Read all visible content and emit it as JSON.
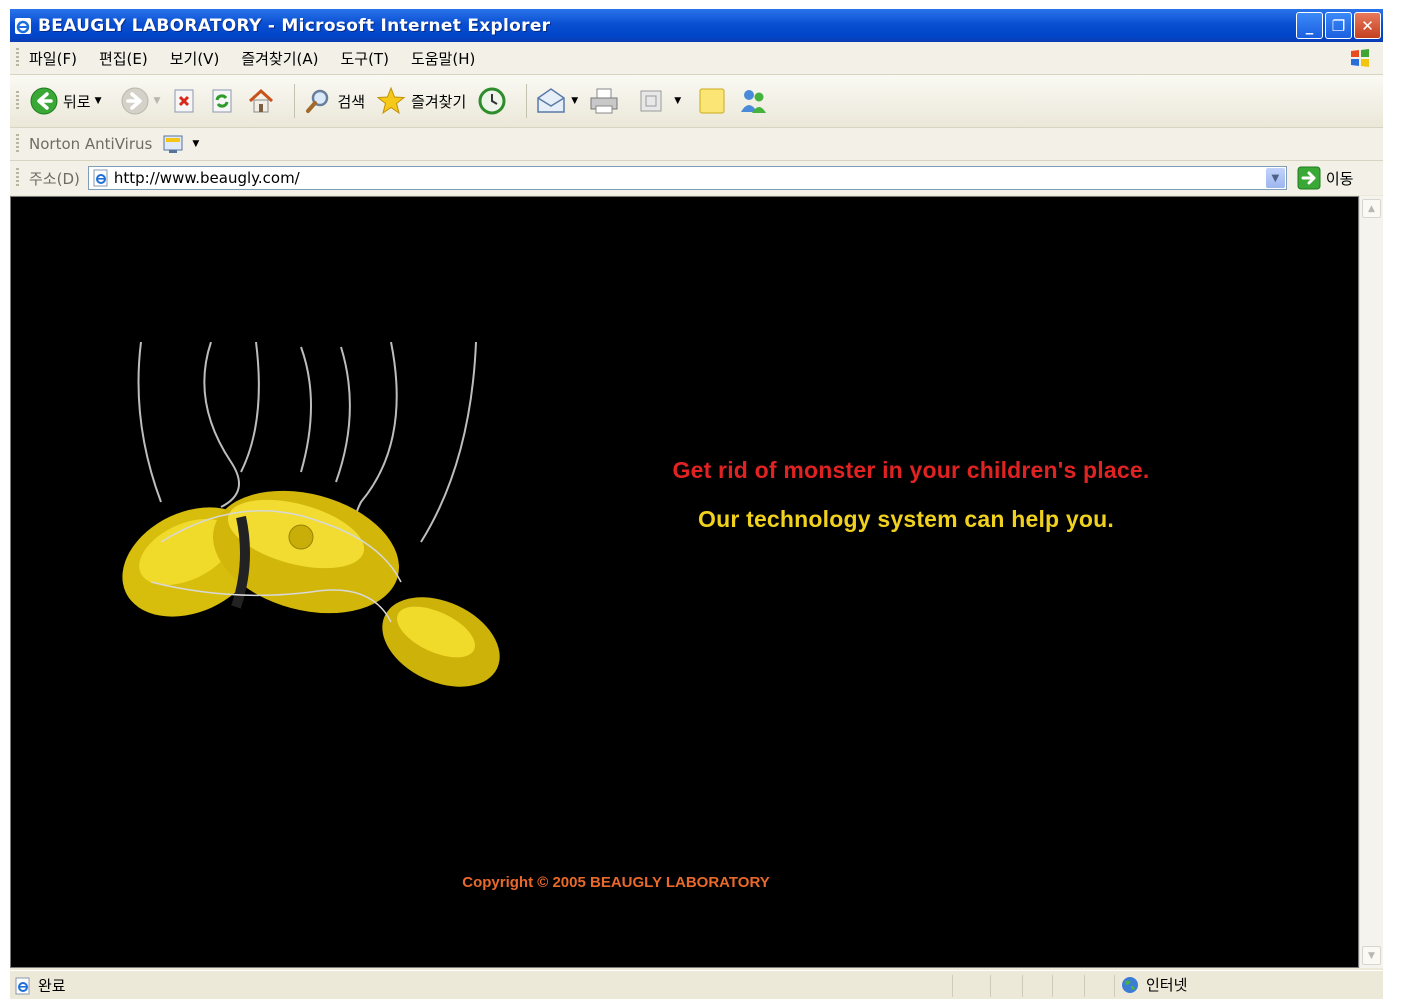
{
  "window": {
    "title": "BEAUGLY LABORATORY - Microsoft Internet Explorer",
    "minimize": "_",
    "restore": "❐",
    "close": "✕"
  },
  "menu": [
    "파일(F)",
    "편집(E)",
    "보기(V)",
    "즐겨찾기(A)",
    "도구(T)",
    "도움말(H)"
  ],
  "toolbar": {
    "back_label": "뒤로",
    "search_label": "검색",
    "favorites_label": "즐겨찾기"
  },
  "norton": {
    "label": "Norton AntiVirus"
  },
  "address": {
    "label": "주소(D)",
    "url": "http://www.beaugly.com/",
    "go_label": "이동"
  },
  "page": {
    "headline": "Get rid of monster in your children's place.",
    "subline": "Our technology system can help you.",
    "copyright": "Copyright © 2005 BEAUGLY LABORATORY"
  },
  "status": {
    "text": "완료",
    "zone": "인터넷"
  },
  "colors": {
    "headline": "#e02222",
    "subline": "#f0d21e",
    "copyright": "#e8692a",
    "robot": "#e3c80e"
  }
}
